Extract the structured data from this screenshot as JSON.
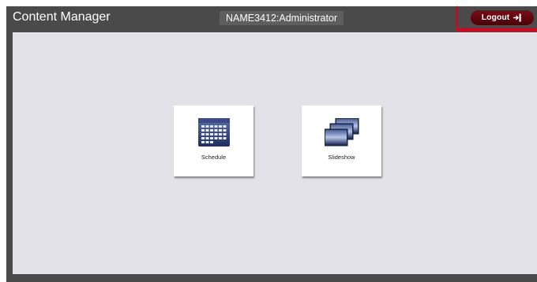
{
  "header": {
    "app_title": "Content Manager",
    "user_label": "NAME3412:Administrator",
    "logout_label": "Logout"
  },
  "tiles": [
    {
      "label": "Schedule",
      "icon": "calendar-icon"
    },
    {
      "label": "Slideshow",
      "icon": "slides-stack-icon"
    }
  ],
  "colors": {
    "frame": "#4a4a4a",
    "workspace": "#e2e2e8",
    "logout_button": "#5c0008",
    "highlight": "#e0001a"
  }
}
